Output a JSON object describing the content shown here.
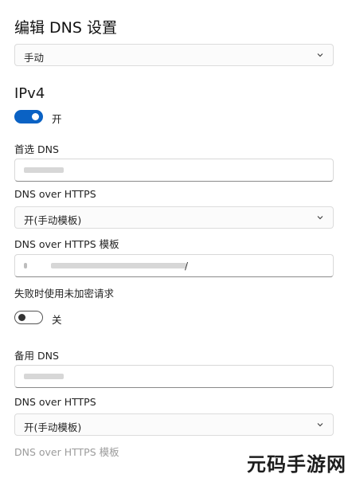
{
  "header": {
    "title": "编辑 DNS 设置"
  },
  "mode_select": {
    "value": "手动",
    "icon": "chevron-down-icon"
  },
  "ipv4": {
    "title": "IPv4",
    "toggle_label": "开",
    "toggle_on": true,
    "preferred_dns": {
      "label": "首选 DNS",
      "value": ""
    },
    "doh": {
      "label": "DNS over HTTPS",
      "value": "开(手动模板)"
    },
    "doh_template": {
      "label": "DNS over HTTPS 模板",
      "value": ""
    },
    "fallback": {
      "label": "失败时使用未加密请求",
      "toggle_label": "关",
      "toggle_on": false
    },
    "alternate_dns": {
      "label": "备用 DNS",
      "value": ""
    },
    "alt_doh": {
      "label": "DNS over HTTPS",
      "value": "开(手动模板)"
    },
    "alt_doh_template": {
      "label": "DNS over HTTPS 模板"
    }
  },
  "watermark": {
    "text": "元码手游网"
  },
  "colors": {
    "accent": "#0a62c4",
    "muted": "#9c9c9c"
  }
}
